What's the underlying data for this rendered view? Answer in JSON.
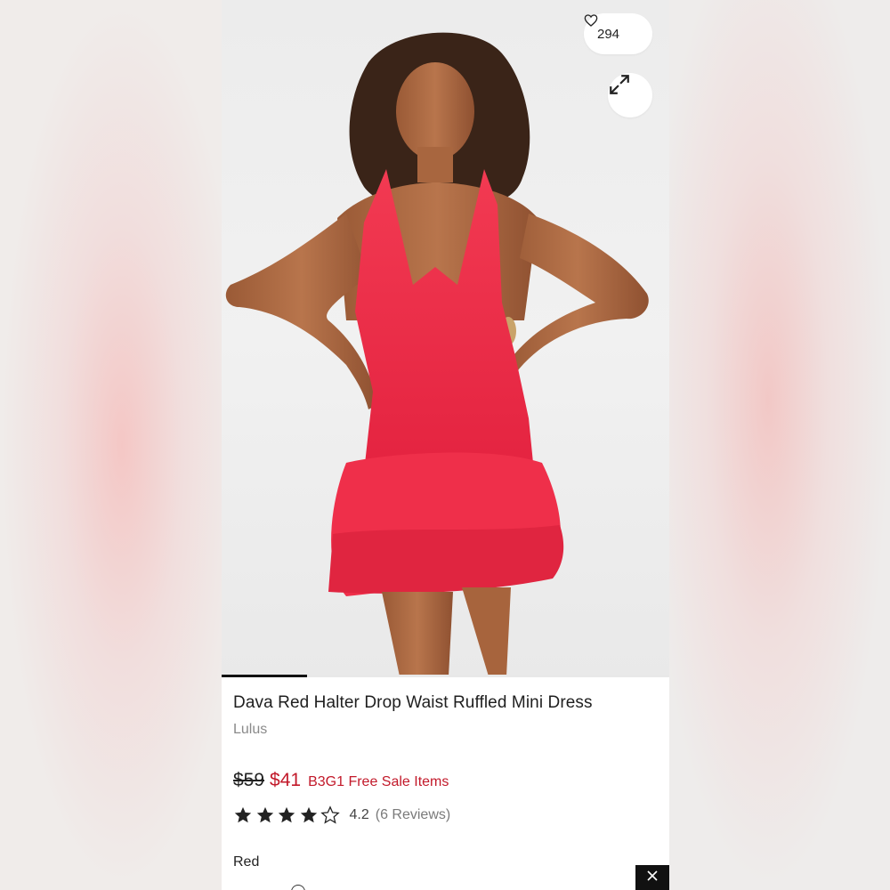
{
  "product": {
    "likes": "294",
    "title": "Dava Red Halter Drop Waist Ruffled Mini Dress",
    "brand": "Lulus",
    "old_price": "$59",
    "new_price": "$41",
    "promo": "B3G1 Free Sale Items",
    "rating": "4.2",
    "rating_stars": 4.2,
    "reviews": "(6 Reviews)",
    "color": "Red"
  },
  "gallery": {
    "progress": 0.19
  },
  "icons": {
    "like": "heart-outline-icon",
    "expand": "expand-arrows-icon",
    "close": "close-icon",
    "star": "star-icon"
  },
  "colors": {
    "sale_red": "#c2192a",
    "dress_red": "#ee2b47",
    "text_dark": "#1f1f1f"
  }
}
